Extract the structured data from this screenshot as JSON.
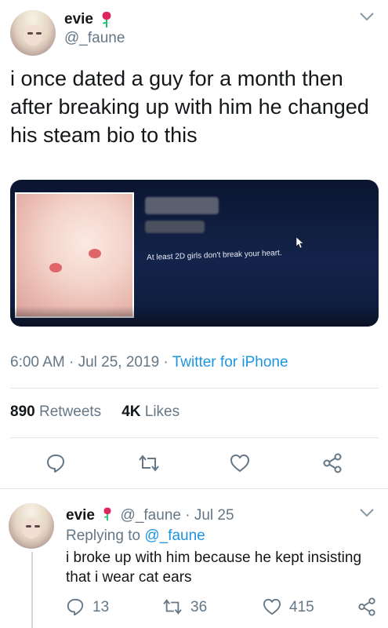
{
  "tweet": {
    "author_name": "evie",
    "author_handle": "@_faune",
    "text": "i once dated a guy for a month then after breaking up with him he changed his steam bio to this",
    "media_caption": "At least 2D girls don't break your heart.",
    "time": "6:00 AM",
    "sep1": "·",
    "date": "Jul 25, 2019",
    "sep2": "·",
    "source": "Twitter for iPhone",
    "retweets_count": "890",
    "retweets_label": "Retweets",
    "likes_count": "4K",
    "likes_label": "Likes"
  },
  "reply": {
    "author_name": "evie",
    "author_handle": "@_faune",
    "sep": "·",
    "date": "Jul 25",
    "replying_prefix": "Replying to",
    "replying_to": "@_faune",
    "text": "i broke up with him because he kept insisting that i wear cat ears",
    "reply_count": "13",
    "retweet_count": "36",
    "like_count": "415"
  },
  "colors": {
    "link": "#1b95e0",
    "secondary_text": "#657786",
    "rose_petal": "#e0245e",
    "rose_leaf": "#17bf63"
  },
  "icons": [
    "chevron-down-icon",
    "rose-emoji-icon",
    "reply-icon",
    "retweet-icon",
    "like-icon",
    "share-icon",
    "cursor-icon"
  ]
}
